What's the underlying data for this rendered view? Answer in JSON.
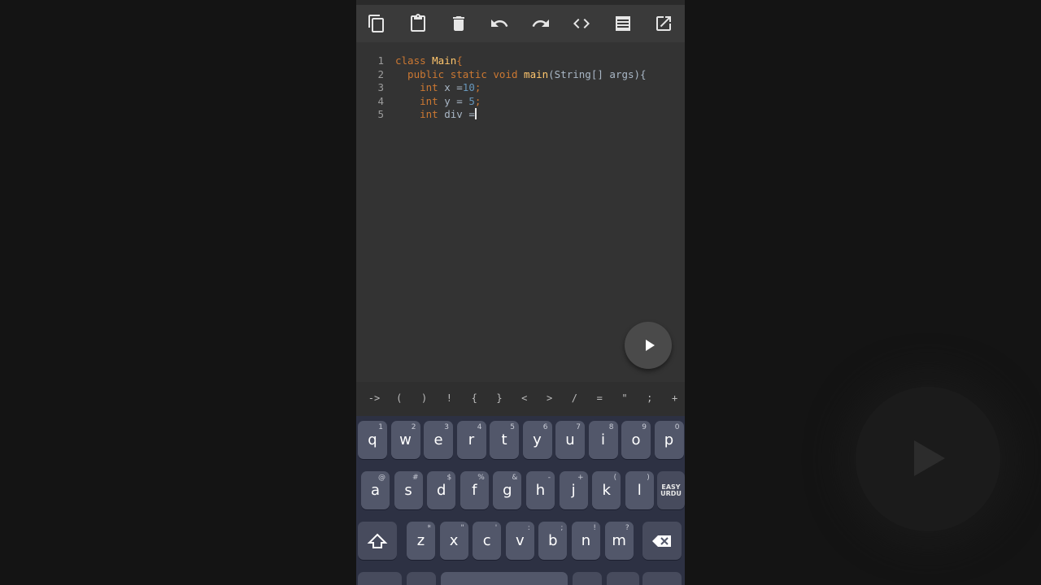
{
  "toolbar": {
    "icons": [
      "copy-icon",
      "paste-icon",
      "delete-icon",
      "undo-icon",
      "redo-icon",
      "code-icon",
      "document-icon",
      "open-external-icon"
    ]
  },
  "editor": {
    "lines": [
      {
        "num": "1",
        "parts": [
          {
            "t": "class ",
            "c": "kw"
          },
          {
            "t": "Main",
            "c": "fn"
          },
          {
            "t": "{",
            "c": "kw"
          }
        ]
      },
      {
        "num": "2",
        "parts": [
          {
            "t": "  public static void ",
            "c": "kw"
          },
          {
            "t": "main",
            "c": "fn"
          },
          {
            "t": "(String[] args){",
            "c": "plain"
          }
        ]
      },
      {
        "num": "3",
        "parts": [
          {
            "t": "    int ",
            "c": "kw"
          },
          {
            "t": "x =",
            "c": "plain"
          },
          {
            "t": "10",
            "c": "num"
          },
          {
            "t": ";",
            "c": "kw"
          }
        ]
      },
      {
        "num": "4",
        "parts": [
          {
            "t": "    int ",
            "c": "kw"
          },
          {
            "t": "y = ",
            "c": "plain"
          },
          {
            "t": "5",
            "c": "num"
          },
          {
            "t": ";",
            "c": "kw"
          }
        ]
      },
      {
        "num": "5",
        "parts": [
          {
            "t": "    int ",
            "c": "kw"
          },
          {
            "t": "div =",
            "c": "plain"
          }
        ],
        "cursor": true
      }
    ]
  },
  "run_button": {
    "icon": "play-icon"
  },
  "symbols": [
    "->",
    "(",
    ")",
    "!",
    "{",
    "}",
    "<",
    ">",
    "/",
    "=",
    "\"",
    ";",
    "+"
  ],
  "keyboard": {
    "row1": [
      {
        "label": "q",
        "hint": "1"
      },
      {
        "label": "w",
        "hint": "2"
      },
      {
        "label": "e",
        "hint": "3"
      },
      {
        "label": "r",
        "hint": "4"
      },
      {
        "label": "t",
        "hint": "5"
      },
      {
        "label": "y",
        "hint": "6"
      },
      {
        "label": "u",
        "hint": "7"
      },
      {
        "label": "i",
        "hint": "8"
      },
      {
        "label": "o",
        "hint": "9"
      },
      {
        "label": "p",
        "hint": "0"
      }
    ],
    "row2": [
      {
        "label": "a",
        "hint": "@"
      },
      {
        "label": "s",
        "hint": "#"
      },
      {
        "label": "d",
        "hint": "$"
      },
      {
        "label": "f",
        "hint": "%"
      },
      {
        "label": "g",
        "hint": "&"
      },
      {
        "label": "h",
        "hint": "-"
      },
      {
        "label": "j",
        "hint": "+"
      },
      {
        "label": "k",
        "hint": "("
      },
      {
        "label": "l",
        "hint": ")"
      }
    ],
    "easy_urdu": [
      "EASY",
      "URDU"
    ],
    "row3": [
      {
        "label": "z",
        "hint": "*"
      },
      {
        "label": "x",
        "hint": "\""
      },
      {
        "label": "c",
        "hint": "'"
      },
      {
        "label": "v",
        "hint": ":"
      },
      {
        "label": "b",
        "hint": ";"
      },
      {
        "label": "n",
        "hint": "!"
      },
      {
        "label": "m",
        "hint": "?"
      }
    ]
  }
}
